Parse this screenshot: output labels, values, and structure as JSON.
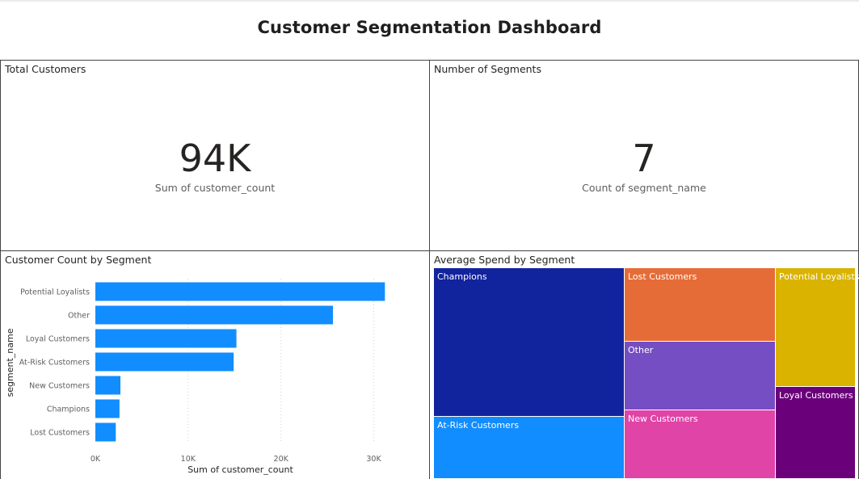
{
  "page": {
    "title": "Customer Segmentation Dashboard"
  },
  "kpi_total": {
    "title": "Total Customers",
    "value": "94K",
    "label": "Sum of customer_count"
  },
  "kpi_segments": {
    "title": "Number of Segments",
    "value": "7",
    "label": "Count of segment_name"
  },
  "bar_panel": {
    "title": "Customer Count by Segment"
  },
  "treemap_panel": {
    "title": "Average Spend by Segment"
  },
  "colors": {
    "bar": "#118dff",
    "champions": "#12239e",
    "at_risk": "#118dff",
    "lost": "#e66c37",
    "other": "#744ec2",
    "new": "#e044a7",
    "potential": "#d9b300",
    "loyal": "#6b007b"
  },
  "chart_data": [
    {
      "type": "bar",
      "orientation": "horizontal",
      "categories": [
        "Potential Loyalists",
        "Other",
        "Loyal Customers",
        "At-Risk Customers",
        "New Customers",
        "Champions",
        "Lost Customers"
      ],
      "values": [
        31200,
        25600,
        15200,
        14900,
        2700,
        2600,
        2200
      ],
      "xlabel": "Sum of customer_count",
      "ylabel": "segment_name",
      "xlim": [
        0,
        33000
      ],
      "xticks": [
        0,
        10000,
        20000,
        30000
      ],
      "xtick_labels": [
        "0K",
        "10K",
        "20K",
        "30K"
      ],
      "grid": true
    },
    {
      "type": "treemap",
      "categories": [
        "Champions",
        "At-Risk Customers",
        "Lost Customers",
        "Other",
        "New Customers",
        "Potential Loyalists",
        "Loyal Customers"
      ],
      "values": [
        2420,
        760,
        1080,
        990,
        880,
        1000,
        740
      ]
    }
  ]
}
